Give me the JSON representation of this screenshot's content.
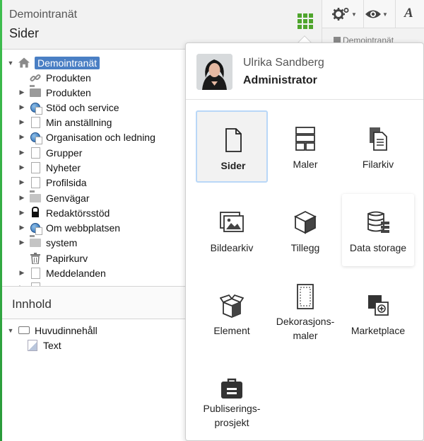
{
  "header": {
    "site_name": "Demointranät",
    "page_title": "Sider",
    "breadcrumb": "Demointranät"
  },
  "toolbar": {
    "font_tool_label": "A"
  },
  "tree": {
    "items": [
      {
        "label": "Demointranät",
        "icon": "home-icon",
        "toggle": "▼",
        "selected": true
      },
      {
        "label": "Produkten",
        "icon": "link-icon",
        "toggle": ""
      },
      {
        "label": "Produkten",
        "icon": "folder-open-icon",
        "toggle": "▶"
      },
      {
        "label": "Stöd och service",
        "icon": "globe-page-icon",
        "toggle": "▶"
      },
      {
        "label": "Min anställning",
        "icon": "page-icon",
        "toggle": "▶"
      },
      {
        "label": "Organisation och ledning",
        "icon": "globe-page-icon",
        "toggle": "▶"
      },
      {
        "label": "Grupper",
        "icon": "page-icon",
        "toggle": "▶"
      },
      {
        "label": "Nyheter",
        "icon": "page-icon",
        "toggle": "▶"
      },
      {
        "label": "Profilsida",
        "icon": "page-icon",
        "toggle": "▶"
      },
      {
        "label": "Genvägar",
        "icon": "folder-icon",
        "toggle": "▶"
      },
      {
        "label": "Redaktörsstöd",
        "icon": "lock-icon",
        "toggle": "▶"
      },
      {
        "label": "Om webbplatsen",
        "icon": "globe-page-icon",
        "toggle": "▶"
      },
      {
        "label": "system",
        "icon": "folder-icon",
        "toggle": "▶"
      },
      {
        "label": "Papirkurv",
        "icon": "trash-icon",
        "toggle": ""
      },
      {
        "label": "Meddelanden",
        "icon": "page-icon",
        "toggle": "▶"
      },
      {
        "label": "",
        "icon": "page-icon",
        "toggle": "▶"
      }
    ]
  },
  "content_panel": {
    "title": "Innhold",
    "items": [
      {
        "label": "Huvudinnehåll",
        "icon": "content-area-icon",
        "toggle": "▼"
      },
      {
        "label": "Text",
        "icon": "text-part-icon",
        "toggle": ""
      }
    ]
  },
  "launcher": {
    "user_name": "Ulrika Sandberg",
    "user_role": "Administrator",
    "apps": [
      {
        "label": "Sider",
        "icon": "page-icon"
      },
      {
        "label": "Maler",
        "icon": "templates-icon"
      },
      {
        "label": "Filarkiv",
        "icon": "file-archive-icon"
      },
      {
        "label": "Bildearkiv",
        "icon": "image-archive-icon"
      },
      {
        "label": "Tillegg",
        "icon": "cube-icon"
      },
      {
        "label": "Data storage",
        "icon": "database-icon"
      },
      {
        "label": "Element",
        "icon": "open-box-icon"
      },
      {
        "label": "Dekorasjons-",
        "label2": "maler",
        "icon": "decoration-template-icon"
      },
      {
        "label": "Marketplace",
        "icon": "marketplace-icon"
      },
      {
        "label": "Publiserings-",
        "label2": "prosjekt",
        "icon": "briefcase-icon"
      }
    ]
  },
  "colors": {
    "accent_green": "#4fa52d",
    "selection_blue": "#4a7fc4",
    "active_tile_border": "#b9d7f7"
  }
}
